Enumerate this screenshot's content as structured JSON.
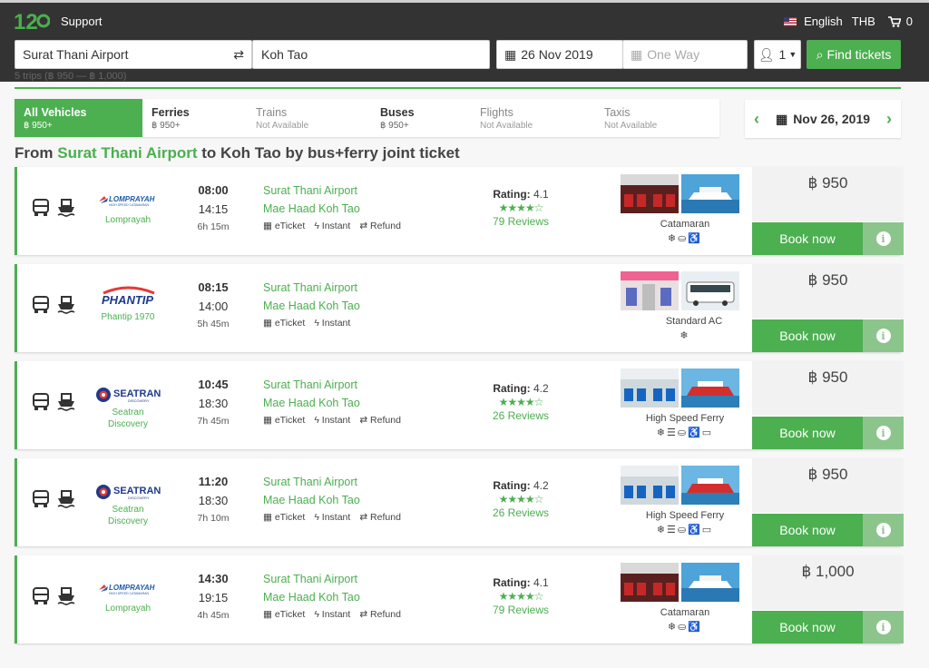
{
  "header": {
    "logo_text": "12Go",
    "support": "Support",
    "language": "English",
    "currency": "THB",
    "cart_count": "0"
  },
  "search": {
    "from": "Surat Thani Airport",
    "to": "Koh Tao",
    "date": "26 Nov 2019",
    "return_placeholder": "One Way",
    "passengers": "1",
    "find_label": "Find tickets"
  },
  "summary": "5 trips (฿ 950 — ฿ 1,000)",
  "tabs": [
    {
      "name": "All Vehicles",
      "sub": "฿ 950+",
      "state": "active"
    },
    {
      "name": "Ferries",
      "sub": "฿ 950+",
      "state": "normal"
    },
    {
      "name": "Trains",
      "sub": "Not Available",
      "state": "disabled"
    },
    {
      "name": "Buses",
      "sub": "฿ 950+",
      "state": "normal"
    },
    {
      "name": "Flights",
      "sub": "Not Available",
      "state": "disabled"
    },
    {
      "name": "Taxis",
      "sub": "Not Available",
      "state": "disabled"
    }
  ],
  "date_nav": {
    "label": "Nov 26, 2019"
  },
  "route_title": {
    "prefix": "From ",
    "origin": "Surat Thani Airport",
    "rest": " to Koh Tao by bus+ferry joint ticket"
  },
  "trips": [
    {
      "operator": "Lomprayah",
      "logo": "lomprayah",
      "dep": "08:00",
      "arr": "14:15",
      "dur": "6h 15m",
      "from": "Surat Thani Airport",
      "to": "Mae Haad Koh Tao",
      "features": [
        "eTicket",
        "Instant",
        "Refund"
      ],
      "rating_label": "Rating:",
      "rating": "4.1",
      "stars": 4,
      "reviews": "79 Reviews",
      "class": "Catamaran",
      "amenities": [
        "ac",
        "seat",
        "toilet"
      ],
      "price": "฿ 950",
      "book": "Book now",
      "photos": [
        "interior-red",
        "catamaran"
      ]
    },
    {
      "operator": "Phantip 1970",
      "logo": "phantip",
      "dep": "08:15",
      "arr": "14:00",
      "dur": "5h 45m",
      "from": "Surat Thani Airport",
      "to": "Mae Haad Koh Tao",
      "features": [
        "eTicket",
        "Instant"
      ],
      "rating_label": "",
      "rating": "",
      "stars": 0,
      "reviews": "",
      "class": "Standard AC",
      "amenities": [
        "ac"
      ],
      "price": "฿ 950",
      "book": "Book now",
      "photos": [
        "interior-bus",
        "bus"
      ]
    },
    {
      "operator": "Seatran Discovery",
      "logo": "seatran",
      "dep": "10:45",
      "arr": "18:30",
      "dur": "7h 45m",
      "from": "Surat Thani Airport",
      "to": "Mae Haad Koh Tao",
      "features": [
        "eTicket",
        "Instant",
        "Refund"
      ],
      "rating_label": "Rating:",
      "rating": "4.2",
      "stars": 4,
      "reviews": "26 Reviews",
      "class": "High Speed Ferry",
      "amenities": [
        "ac",
        "food",
        "seat",
        "toilet",
        "tv"
      ],
      "price": "฿ 950",
      "book": "Book now",
      "photos": [
        "interior-blue",
        "ferry-red"
      ]
    },
    {
      "operator": "Seatran Discovery",
      "logo": "seatran",
      "dep": "11:20",
      "arr": "18:30",
      "dur": "7h 10m",
      "from": "Surat Thani Airport",
      "to": "Mae Haad Koh Tao",
      "features": [
        "eTicket",
        "Instant",
        "Refund"
      ],
      "rating_label": "Rating:",
      "rating": "4.2",
      "stars": 4,
      "reviews": "26 Reviews",
      "class": "High Speed Ferry",
      "amenities": [
        "ac",
        "food",
        "seat",
        "toilet",
        "tv"
      ],
      "price": "฿ 950",
      "book": "Book now",
      "photos": [
        "interior-blue",
        "ferry-red"
      ]
    },
    {
      "operator": "Lomprayah",
      "logo": "lomprayah",
      "dep": "14:30",
      "arr": "19:15",
      "dur": "4h 45m",
      "from": "Surat Thani Airport",
      "to": "Mae Haad Koh Tao",
      "features": [
        "eTicket",
        "Instant",
        "Refund"
      ],
      "rating_label": "Rating:",
      "rating": "4.1",
      "stars": 4,
      "reviews": "79 Reviews",
      "class": "Catamaran",
      "amenities": [
        "ac",
        "seat",
        "toilet"
      ],
      "price": "฿ 1,000",
      "book": "Book now",
      "photos": [
        "interior-red",
        "catamaran"
      ]
    }
  ],
  "colors": {
    "accent": "#4caf50",
    "header": "#333333",
    "info": "#8bc58c"
  }
}
